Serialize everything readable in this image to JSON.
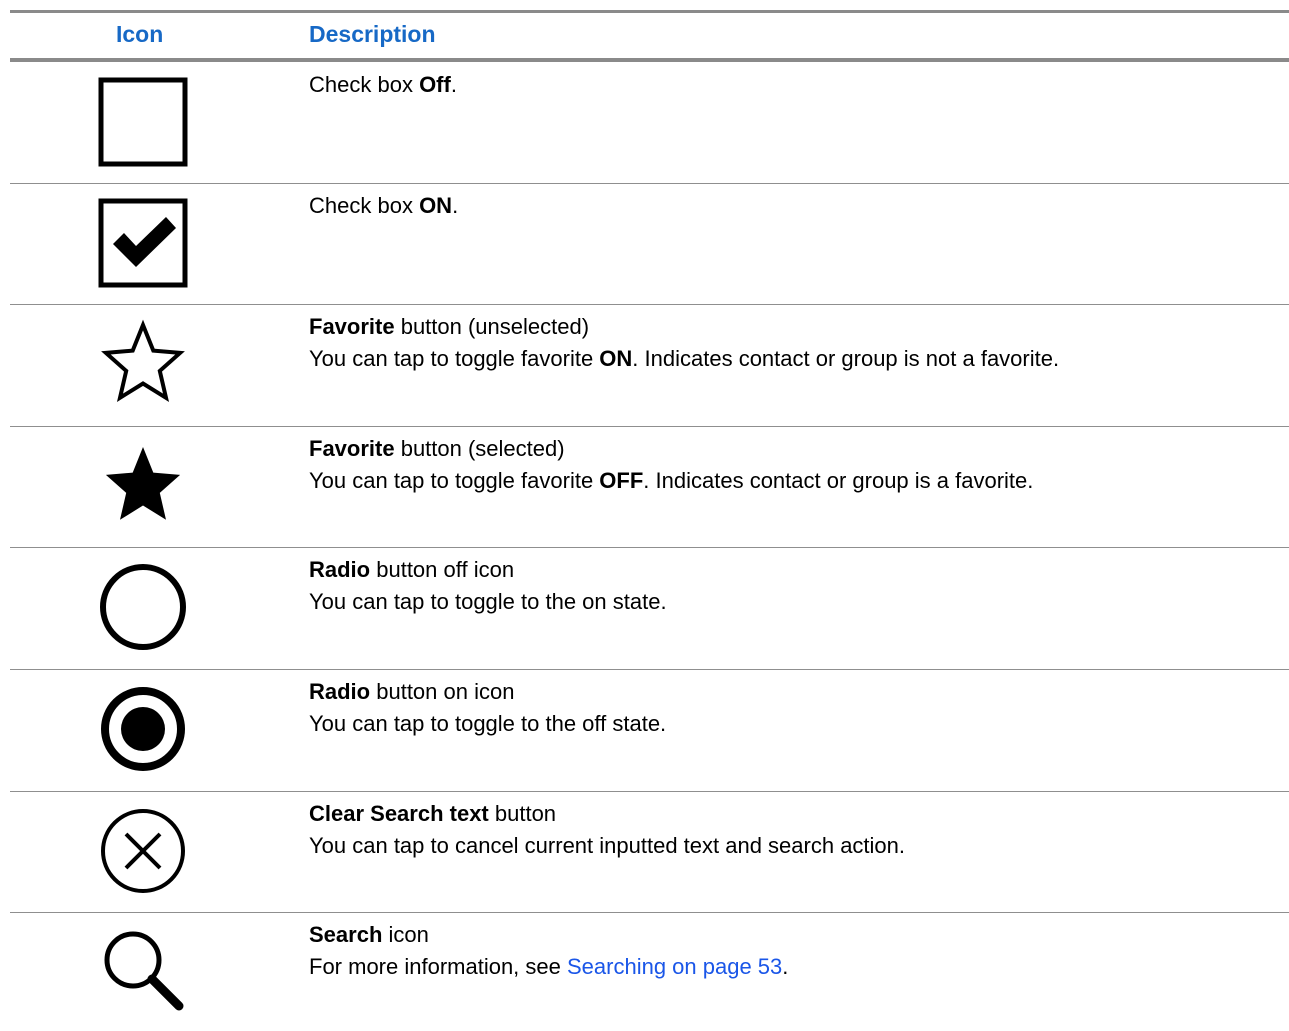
{
  "header": {
    "icon": "Icon",
    "description": "Description"
  },
  "rows": [
    {
      "icon": "checkbox-off-icon",
      "l1a": "Check box ",
      "l1b": "Off",
      "l1c": "."
    },
    {
      "icon": "checkbox-on-icon",
      "l1a": "Check box ",
      "l1b": "ON",
      "l1c": "."
    },
    {
      "icon": "favorite-unselected-star-icon",
      "l1b": "Favorite",
      "l1c": " button (unselected)",
      "l2a": "You can tap to toggle favorite ",
      "l2b": "ON",
      "l2c": ". Indicates contact or group is not a favorite."
    },
    {
      "icon": "favorite-selected-star-icon",
      "l1b": "Favorite",
      "l1c": " button (selected)",
      "l2a": "You can tap to toggle favorite ",
      "l2b": "OFF",
      "l2c": ". Indicates contact or group is a favorite."
    },
    {
      "icon": "radio-off-icon",
      "l1b": "Radio",
      "l1c": " button off icon",
      "l2a": "You can tap to toggle to the on state."
    },
    {
      "icon": "radio-on-icon",
      "l1b": "Radio",
      "l1c": " button on icon",
      "l2a": "You can tap to toggle to the off state."
    },
    {
      "icon": "clear-search-x-icon",
      "l1b": "Clear Search text",
      "l1c": " button",
      "l2a": "You can tap to cancel current inputted text and search action."
    },
    {
      "icon": "search-magnifier-icon",
      "l1b": "Search",
      "l1c": " icon",
      "l2a": "For more information, see ",
      "l2link": "Searching on page 53",
      "l2c": "."
    }
  ],
  "colors": {
    "header_text": "#1769c6",
    "link": "#1a56e8",
    "rule": "#8a8a8a"
  }
}
